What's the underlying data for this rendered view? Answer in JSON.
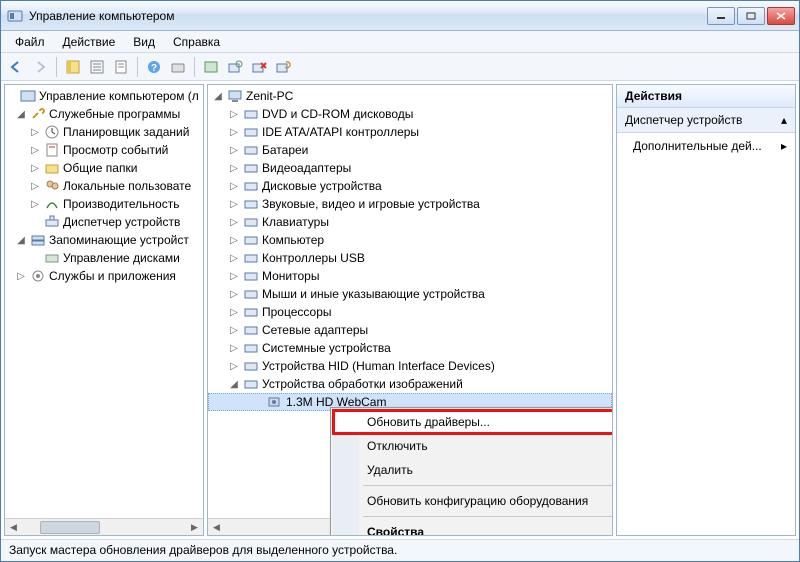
{
  "window": {
    "title": "Управление компьютером"
  },
  "menu": {
    "file": "Файл",
    "action": "Действие",
    "view": "Вид",
    "help": "Справка"
  },
  "left_tree": {
    "root": "Управление компьютером (л",
    "g1": "Служебные программы",
    "g1_items": [
      "Планировщик заданий",
      "Просмотр событий",
      "Общие папки",
      "Локальные пользовате",
      "Производительность",
      "Диспетчер устройств"
    ],
    "g2": "Запоминающие устройст",
    "g2_items": [
      "Управление дисками"
    ],
    "g3": "Службы и приложения"
  },
  "center_tree": {
    "root": "Zenit-PC",
    "cats": [
      "DVD и CD-ROM дисководы",
      "IDE ATA/ATAPI контроллеры",
      "Батареи",
      "Видеоадаптеры",
      "Дисковые устройства",
      "Звуковые, видео и игровые устройства",
      "Клавиатуры",
      "Компьютер",
      "Контроллеры USB",
      "Мониторы",
      "Мыши и иные указывающие устройства",
      "Процессоры",
      "Сетевые адаптеры",
      "Системные устройства",
      "Устройства HID (Human Interface Devices)",
      "Устройства обработки изображений"
    ],
    "selected_device": "1.3M HD WebCam"
  },
  "context_menu": {
    "update": "Обновить драйверы...",
    "disable": "Отключить",
    "delete": "Удалить",
    "refresh": "Обновить конфигурацию оборудования",
    "props": "Свойства"
  },
  "actions_pane": {
    "header": "Действия",
    "section": "Диспетчер устройств",
    "more": "Дополнительные дей..."
  },
  "status": "Запуск мастера обновления драйверов для выделенного устройства."
}
